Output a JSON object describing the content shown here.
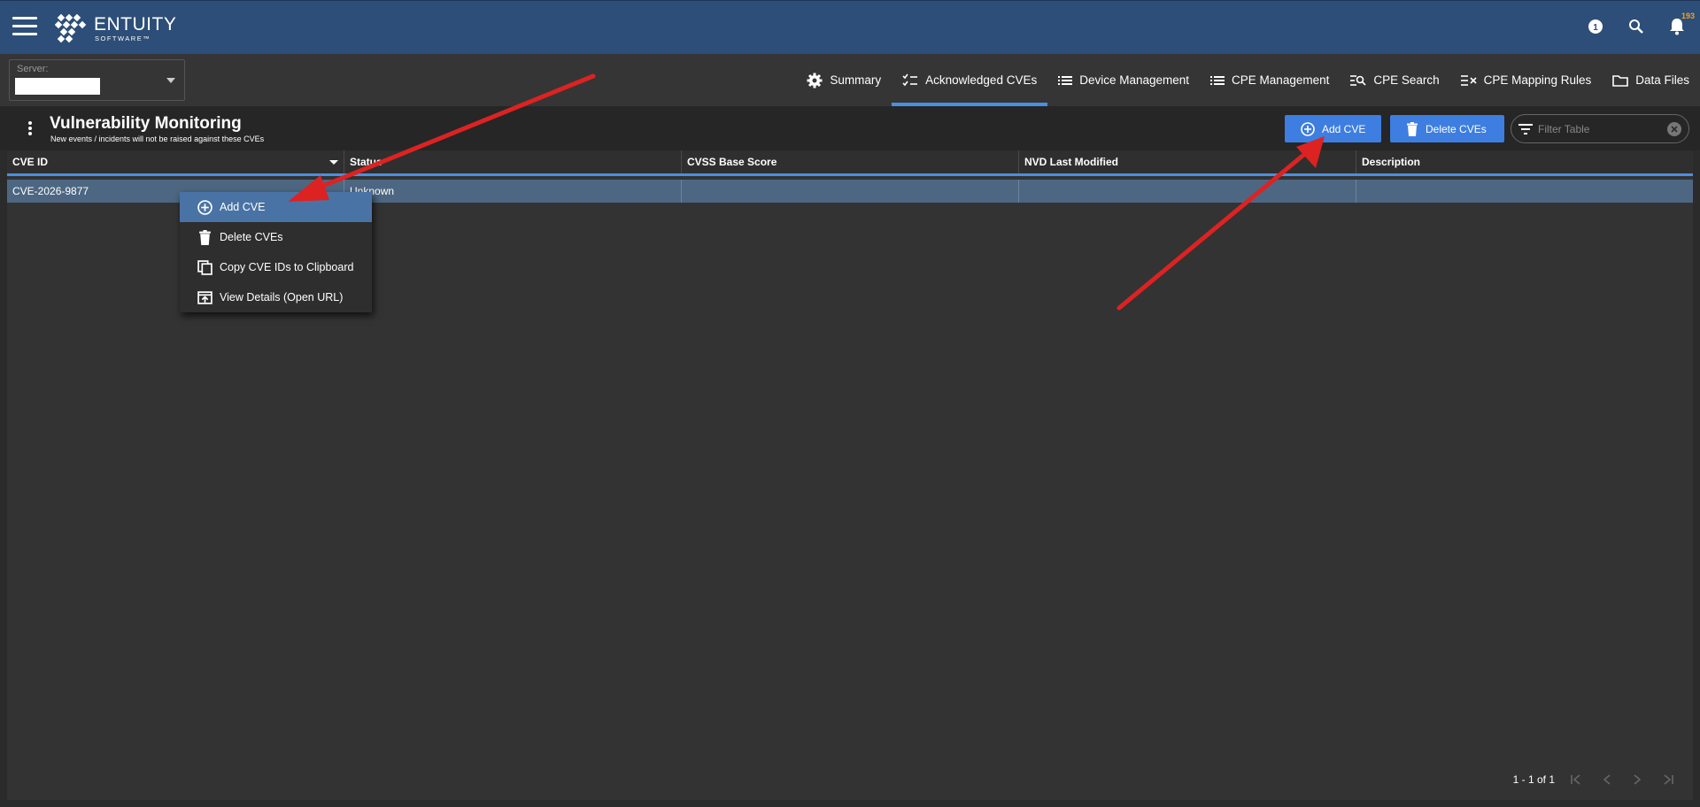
{
  "header": {
    "logo_main": "ENTUITY",
    "logo_sub": "SOFTWARE™",
    "notification_count": "193"
  },
  "server": {
    "label": "Server:"
  },
  "tabs": [
    {
      "label": "Summary",
      "icon": "gear-icon"
    },
    {
      "label": "Acknowledged CVEs",
      "icon": "checklist-icon",
      "active": true
    },
    {
      "label": "Device Management",
      "icon": "list-icon"
    },
    {
      "label": "CPE Management",
      "icon": "list-icon"
    },
    {
      "label": "CPE Search",
      "icon": "list-search-icon"
    },
    {
      "label": "CPE Mapping Rules",
      "icon": "list-rules-icon"
    },
    {
      "label": "Data Files",
      "icon": "folder-icon"
    }
  ],
  "page": {
    "title": "Vulnerability Monitoring",
    "subtitle": "New events / incidents will not be raised against these CVEs"
  },
  "toolbar": {
    "add_label": "Add CVE",
    "delete_label": "Delete CVEs",
    "filter_placeholder": "Filter Table"
  },
  "table": {
    "columns": [
      "CVE ID",
      "Status",
      "CVSS Base Score",
      "NVD Last Modified",
      "Description"
    ],
    "rows": [
      [
        "CVE-2026-9877",
        "Unknown",
        "",
        "",
        ""
      ]
    ]
  },
  "context_menu": {
    "items": [
      "Add CVE",
      "Delete CVEs",
      "Copy CVE IDs to Clipboard",
      "View Details (Open URL)"
    ]
  },
  "pager": {
    "range": "1 - 1 of 1"
  },
  "colors": {
    "header_bg": "#2d4e78",
    "accent": "#4a90e2",
    "button": "#3d7ee0",
    "selected_row": "#4d6782",
    "menu_highlight": "#4a73a5",
    "annotation_arrow": "#dd2222"
  }
}
